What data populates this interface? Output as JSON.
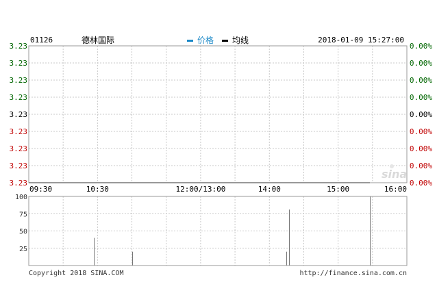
{
  "header": {
    "code": "01126",
    "name": "德林国际",
    "legend_price": "价格",
    "legend_avg": "均线",
    "datetime": "2018-01-09 15:27:00"
  },
  "footer": {
    "copyright": "Copyright 2018 SINA.COM",
    "url": "http://finance.sina.com.cn"
  },
  "watermark": "sina",
  "colors": {
    "price_line": "#1a88c7",
    "avg_line": "#000000",
    "up": "#c00000",
    "down": "#006600",
    "neutral": "#000000",
    "grid": "#c8c8c8",
    "border": "#999999",
    "volume_bar": "#777777"
  },
  "chart_data": [
    {
      "type": "line",
      "title": "",
      "x_ticks": [
        "09:30",
        "10:30",
        "12:00/13:00",
        "14:00",
        "15:00",
        "16:00"
      ],
      "y_left_ticks": [
        "3.23",
        "3.23",
        "3.23",
        "3.23",
        "3.23",
        "3.23",
        "3.23",
        "3.23",
        "3.23"
      ],
      "y_right_ticks": [
        "0.00%",
        "0.00%",
        "0.00%",
        "0.00%",
        "0.00%",
        "0.00%",
        "0.00%",
        "0.00%",
        "0.00%"
      ],
      "tick_colors": [
        "down",
        "down",
        "down",
        "down",
        "neutral",
        "up",
        "up",
        "up",
        "up"
      ],
      "series": [
        {
          "name": "价格",
          "values": []
        },
        {
          "name": "均线",
          "values": []
        }
      ],
      "grid": true
    },
    {
      "type": "bar",
      "title": "",
      "y_ticks": [
        100,
        75,
        50,
        25
      ],
      "ylim": [
        0,
        100
      ],
      "bars": [
        {
          "time": "10:27",
          "value": 40
        },
        {
          "time": "11:00",
          "value": 20
        },
        {
          "time": "14:15",
          "value": 20
        },
        {
          "time": "14:17",
          "value": 81
        },
        {
          "time": "15:28",
          "value": 100
        }
      ],
      "grid": true
    }
  ]
}
